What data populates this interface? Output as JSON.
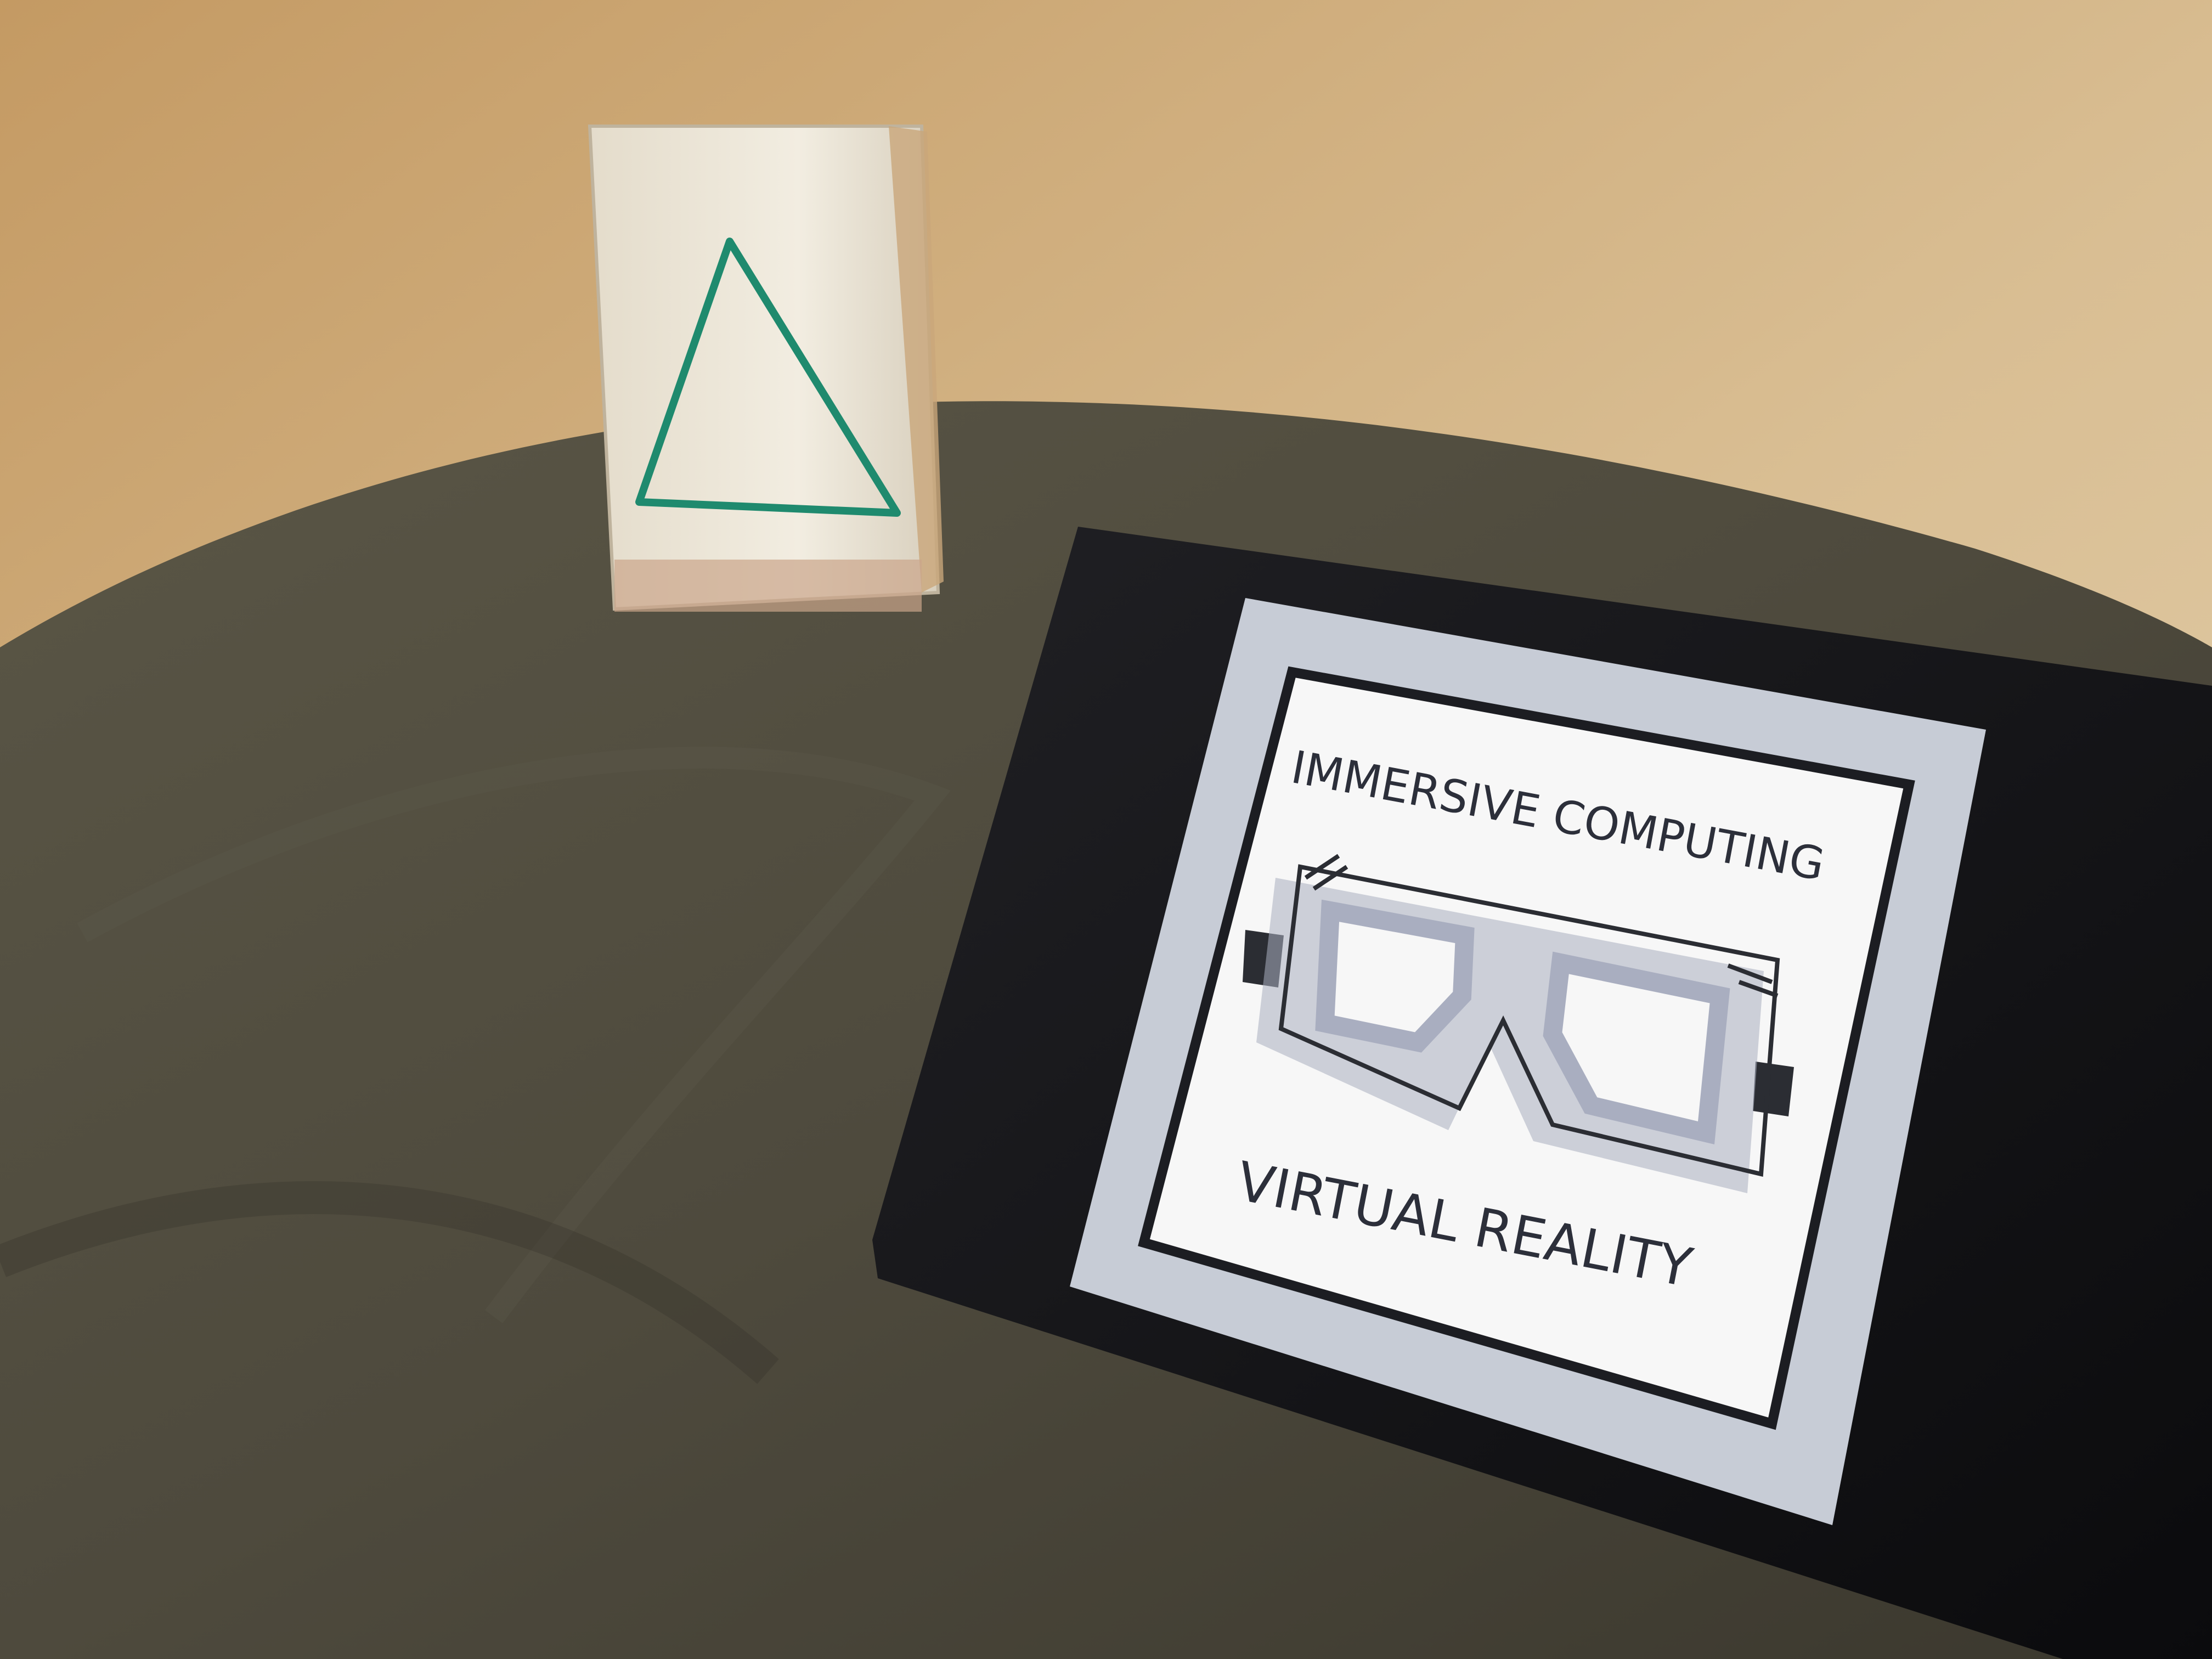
{
  "screen": {
    "title_top": "IMMERSIVE COMPUTING",
    "title_bottom": "VIRTUAL REALITY"
  },
  "colors": {
    "wall": "#d6b98e",
    "blanket": "#4d4a3d",
    "bag": "#efe9dc",
    "triangle": "#1f8a6e",
    "tablet_bezel": "#121214",
    "screen_mat": "#c7ccd6",
    "screen_panel": "#f7f7f7",
    "headset_gray": "#a9aec0",
    "headset_dark": "#2b2d33"
  },
  "objects": {
    "bag_icon": "triangle-icon",
    "headset_icon": "vr-headset-icon"
  }
}
